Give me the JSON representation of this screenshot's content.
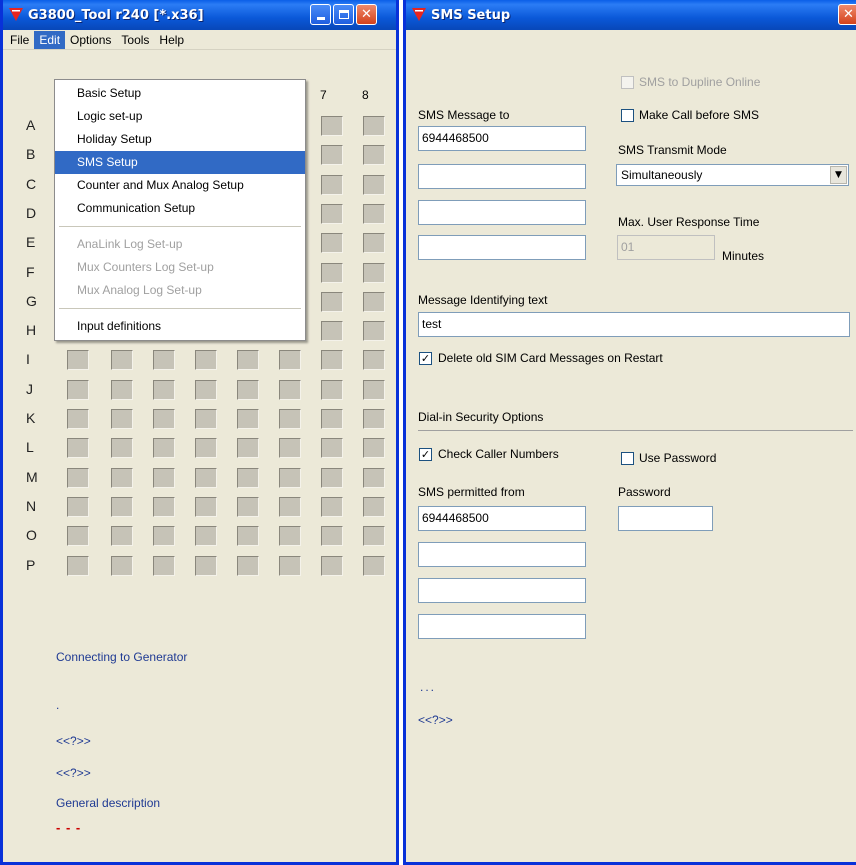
{
  "main_window": {
    "title": "G3800_Tool r240 [*.x36]",
    "menu": [
      "File",
      "Edit",
      "Options",
      "Tools",
      "Help"
    ],
    "active_menu": "Edit",
    "col_headers": [
      "7",
      "8"
    ],
    "row_headers": [
      "A",
      "B",
      "C",
      "D",
      "E",
      "F",
      "G",
      "H",
      "I",
      "J",
      "K",
      "L",
      "M",
      "N",
      "O",
      "P"
    ],
    "status": "Connecting to Generator",
    "dot": ".",
    "link1": "<<?>>",
    "link2": "<<?>>",
    "general_description": "General description",
    "dashes": "- - -"
  },
  "edit_menu": {
    "items": [
      {
        "label": "Basic Setup",
        "state": "normal"
      },
      {
        "label": "Logic set-up",
        "state": "normal"
      },
      {
        "label": "Holiday Setup",
        "state": "normal"
      },
      {
        "label": "SMS Setup",
        "state": "selected"
      },
      {
        "label": "Counter and Mux Analog Setup",
        "state": "normal"
      },
      {
        "label": "Communication Setup",
        "state": "normal"
      },
      {
        "label": "AnaLink Log Set-up",
        "state": "disabled"
      },
      {
        "label": "Mux Counters Log Set-up",
        "state": "disabled"
      },
      {
        "label": "Mux Analog Log Set-up",
        "state": "disabled"
      },
      {
        "label": "Input definitions",
        "state": "normal"
      }
    ]
  },
  "sms_window": {
    "title": "SMS Setup",
    "sms_to_dupline_online": "SMS to Dupline Online",
    "make_call_before_sms": "Make Call before SMS",
    "sms_message_to_label": "SMS Message to",
    "sms_message_to": [
      "6944468500",
      "",
      "",
      ""
    ],
    "transmit_mode_label": "SMS Transmit Mode",
    "transmit_mode_value": "Simultaneously",
    "max_response_label": "Max. User Response Time",
    "max_response_value": "01",
    "minutes_label": "Minutes",
    "message_text_label": "Message Identifying text",
    "message_text_value": "test",
    "delete_old_label": "Delete old SIM Card Messages on Restart",
    "dialin_label": "Dial-in Security Options",
    "check_caller_label": "Check Caller Numbers",
    "use_password_label": "Use Password",
    "sms_permitted_label": "SMS permitted from",
    "sms_permitted_from": [
      "6944468500",
      "",
      "",
      ""
    ],
    "password_label": "Password",
    "password_value": "",
    "dots": "...",
    "link": "<<?>>"
  },
  "checkboxes": {
    "sms_to_dupline_online": false,
    "make_call_before_sms": false,
    "delete_old_messages": true,
    "check_caller_numbers": true,
    "use_password": false
  },
  "colors": {
    "titlebar": "#0a58d8",
    "selection": "#316ac5",
    "link": "#1f3a93",
    "dash": "#cc0000"
  }
}
